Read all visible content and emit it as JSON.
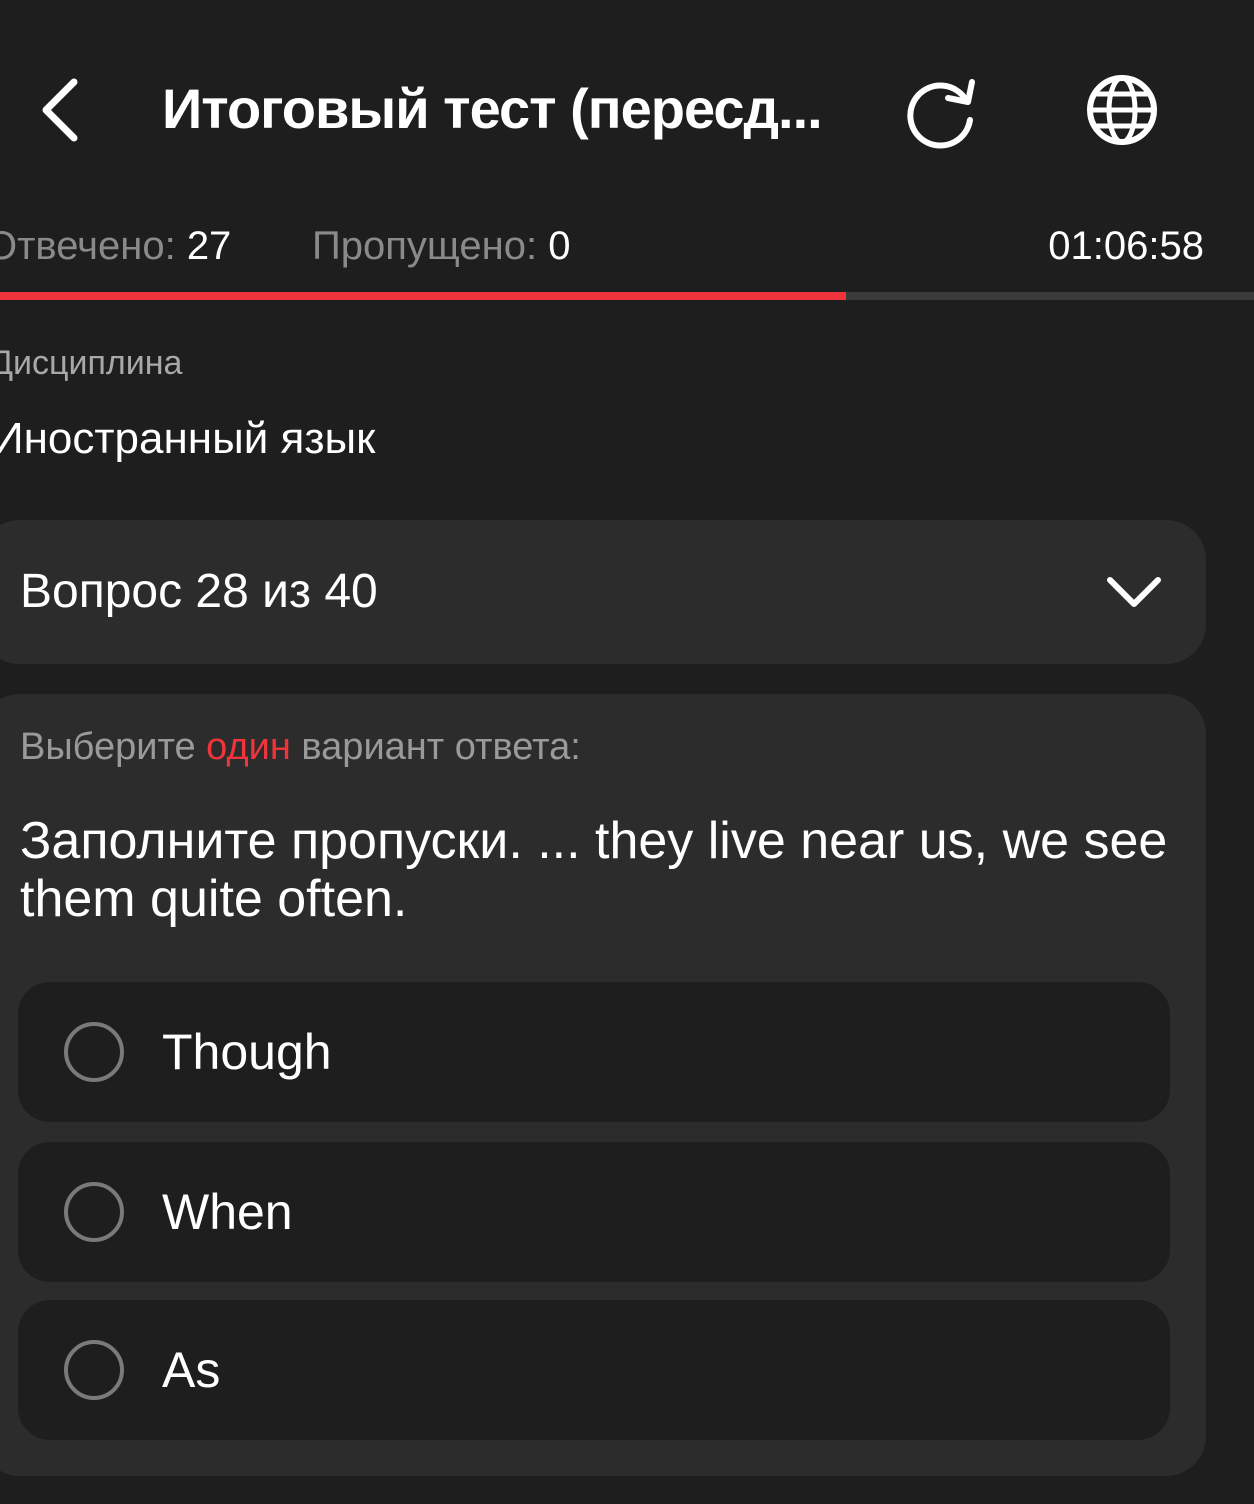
{
  "header": {
    "title": "Итоговый тест (пересд...",
    "back_icon": "chevron-left-icon",
    "reload_icon": "reload-icon",
    "language_icon": "globe-icon"
  },
  "stats": {
    "answered_label": "Отвечено:",
    "answered_value": "27",
    "skipped_label": "Пропущено:",
    "skipped_value": "0",
    "timer": "01:06:58"
  },
  "progress": {
    "fraction": 0.675,
    "color": "#f0343b"
  },
  "discipline": {
    "label": "Дисциплина",
    "value": "Иностранный язык"
  },
  "question_selector": {
    "label": "Вопрос 28 из 40",
    "icon": "chevron-down-icon"
  },
  "question": {
    "instruction_prefix": "Выберите ",
    "instruction_accent": "один",
    "instruction_suffix": " вариант ответа:",
    "text": "Заполните пропуски. ... they live near us, we see them quite often.",
    "options": [
      {
        "label": "Though"
      },
      {
        "label": "When"
      },
      {
        "label": "As"
      }
    ]
  },
  "colors": {
    "background": "#1e1e1f",
    "card": "#2c2c2d",
    "accent": "#f0343b"
  }
}
